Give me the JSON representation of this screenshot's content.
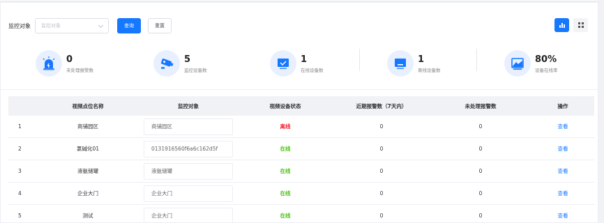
{
  "filter": {
    "label": "监控对象",
    "select_placeholder": "监控对象",
    "query_button": "查询",
    "reset_button": "重置"
  },
  "stats": [
    {
      "value": "0",
      "label": "未处理报警数",
      "icon": "alarm-icon"
    },
    {
      "value": "5",
      "label": "监控设备数",
      "icon": "camera-icon"
    },
    {
      "value": "1",
      "label": "在线设备数",
      "icon": "monitor-online-icon"
    },
    {
      "value": "1",
      "label": "离线设备数",
      "icon": "monitor-offline-icon"
    },
    {
      "value": "80%",
      "label": "设备在线率",
      "icon": "online-rate-icon"
    }
  ],
  "table": {
    "headers": [
      "",
      "视频点位名称",
      "监控对象",
      "视频设备状态",
      "近期报警数（7天内）",
      "未处理报警数",
      "操作"
    ],
    "rows": [
      {
        "index": "1",
        "name": "商铺园区",
        "object": "商铺园区",
        "status": "离线",
        "recent_alarms": "0",
        "pending_alarms": "0",
        "action": "查看"
      },
      {
        "index": "2",
        "name": "氯碱化01",
        "object": "0131916560f6a6c162d5f",
        "status": "在线",
        "recent_alarms": "0",
        "pending_alarms": "0",
        "action": "查看"
      },
      {
        "index": "3",
        "name": "液氨储罐",
        "object": "液氨储罐",
        "status": "在线",
        "recent_alarms": "0",
        "pending_alarms": "0",
        "action": "查看"
      },
      {
        "index": "4",
        "name": "企业大门",
        "object": "企业大门",
        "status": "在线",
        "recent_alarms": "0",
        "pending_alarms": "0",
        "action": "查看"
      },
      {
        "index": "5",
        "name": "测试",
        "object": "企业大门",
        "status": "在线",
        "recent_alarms": "0",
        "pending_alarms": "0",
        "action": "查看"
      }
    ]
  },
  "colors": {
    "primary": "#1677ff",
    "online": "#52c41a",
    "offline": "#f5222d"
  }
}
